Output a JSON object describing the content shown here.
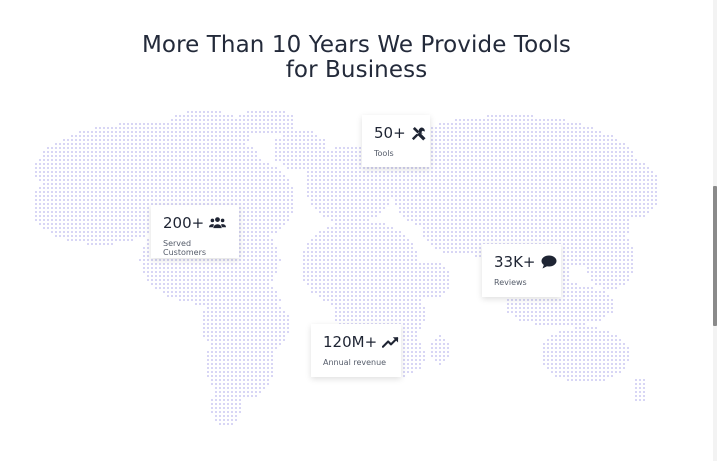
{
  "page": {
    "heading_line1": "More Than 10 Years We Provide Tools",
    "heading_line2": "for Business"
  },
  "colors": {
    "map_dots": "#cbc9f2",
    "text": "#1e2433",
    "label": "#555c6a"
  },
  "stats": [
    {
      "value": "50+",
      "label": "Tools",
      "icon": "tools-icon"
    },
    {
      "value": "200+",
      "label": "Served Customers",
      "icon": "users-icon"
    },
    {
      "value": "33K+",
      "label": "Reviews",
      "icon": "comment-icon"
    },
    {
      "value": "120M+",
      "label": "Annual revenue",
      "icon": "trending-up-icon"
    }
  ]
}
